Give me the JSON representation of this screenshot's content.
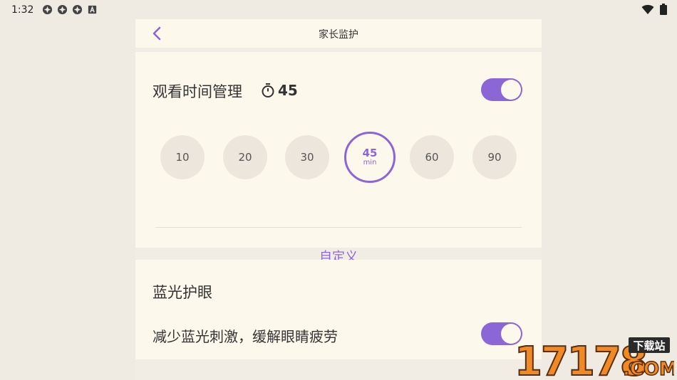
{
  "status": {
    "time": "1:32"
  },
  "header": {
    "title": "家长监护"
  },
  "watch_time": {
    "label": "观看时间管理",
    "value": "45",
    "enabled": true,
    "options": [
      {
        "value": "10"
      },
      {
        "value": "20"
      },
      {
        "value": "30"
      },
      {
        "value": "45",
        "unit": "min",
        "selected": true
      },
      {
        "value": "60"
      },
      {
        "value": "90"
      }
    ],
    "custom_label": "自定义"
  },
  "blue_light": {
    "title": "蓝光护眼",
    "desc": "减少蓝光刺激，缓解眼睛疲劳",
    "enabled": true
  },
  "watermark": {
    "brand": "17178",
    "suffix": ".COM",
    "badge": "下载站"
  },
  "colors": {
    "accent": "#8b66d6",
    "card": "#fdf8ec",
    "bg": "#efebe3",
    "chip": "#ede6dc"
  }
}
